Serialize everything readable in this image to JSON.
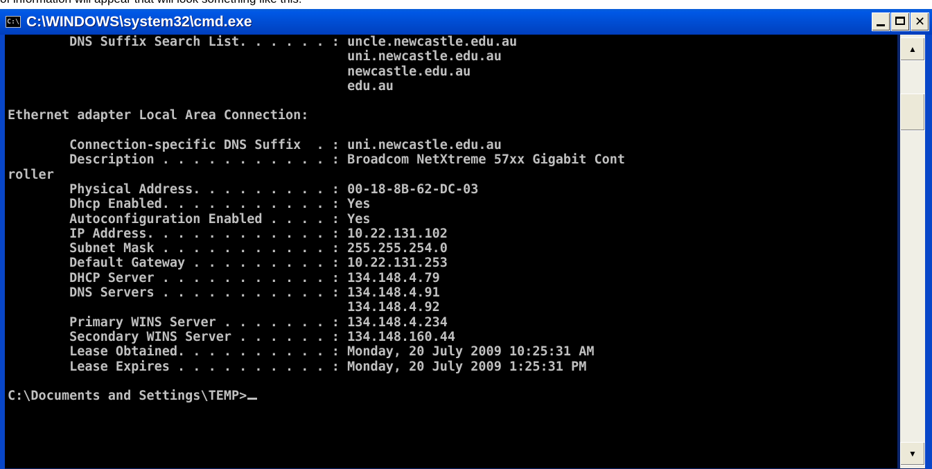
{
  "page_caption": "of information will appear that will look something like this:",
  "window": {
    "title": "C:\\WINDOWS\\system32\\cmd.exe",
    "icon_label": "C:\\",
    "buttons": [
      "minimize",
      "maximize",
      "close"
    ]
  },
  "console": {
    "lines": [
      "        DNS Suffix Search List. . . . . . : uncle.newcastle.edu.au",
      "                                            uni.newcastle.edu.au",
      "                                            newcastle.edu.au",
      "                                            edu.au",
      "",
      "Ethernet adapter Local Area Connection:",
      "",
      "        Connection-specific DNS Suffix  . : uni.newcastle.edu.au",
      "        Description . . . . . . . . . . . : Broadcom NetXtreme 57xx Gigabit Cont",
      "roller",
      "        Physical Address. . . . . . . . . : 00-18-8B-62-DC-03",
      "        Dhcp Enabled. . . . . . . . . . . : Yes",
      "        Autoconfiguration Enabled . . . . : Yes",
      "        IP Address. . . . . . . . . . . . : 10.22.131.102",
      "        Subnet Mask . . . . . . . . . . . : 255.255.254.0",
      "        Default Gateway . . . . . . . . . : 10.22.131.253",
      "        DHCP Server . . . . . . . . . . . : 134.148.4.79",
      "        DNS Servers . . . . . . . . . . . : 134.148.4.91",
      "                                            134.148.4.92",
      "        Primary WINS Server . . . . . . . : 134.148.4.234",
      "        Secondary WINS Server . . . . . . : 134.148.160.44",
      "        Lease Obtained. . . . . . . . . . : Monday, 20 July 2009 10:25:31 AM",
      "        Lease Expires . . . . . . . . . . : Monday, 20 July 2009 1:25:31 PM",
      ""
    ],
    "prompt": "C:\\Documents and Settings\\TEMP>"
  },
  "colors": {
    "console_bg": "#000000",
    "console_fg": "#c0c0c0",
    "titlebar": "#0050d8"
  }
}
